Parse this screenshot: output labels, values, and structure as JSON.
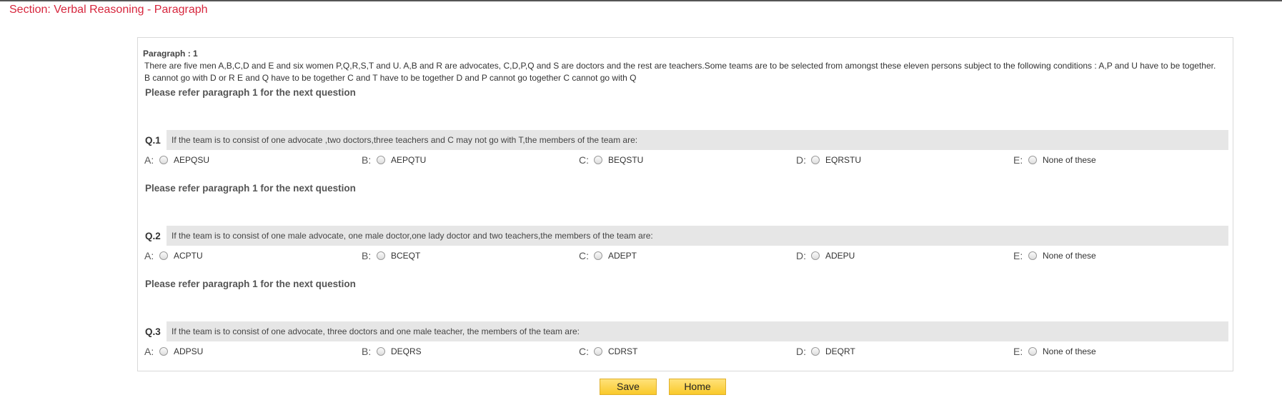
{
  "section_title": "Section: Verbal Reasoning - Paragraph",
  "paragraph": {
    "label": "Paragraph : 1",
    "text": "There are five men A,B,C,D and E and six women P,Q,R,S,T and U. A,B and R are advocates, C,D,P,Q and S are doctors and the rest are teachers.Some teams are to be selected from amongst these eleven persons subject to the following conditions : A,P and U have to be together. B cannot go with D or R E and Q have to be together C and T have to be together D and P cannot go together C cannot go with Q"
  },
  "questions": [
    {
      "refer": "Please refer paragraph 1 for the next question",
      "number": "Q.1",
      "text": "If the team is to consist of one advocate ,two doctors,three teachers and C may not go with T,the members of the team are:",
      "options": [
        {
          "letter": "A:",
          "label": "AEPQSU"
        },
        {
          "letter": "B:",
          "label": "AEPQTU"
        },
        {
          "letter": "C:",
          "label": "BEQSTU"
        },
        {
          "letter": "D:",
          "label": "EQRSTU"
        },
        {
          "letter": "E:",
          "label": "None of these"
        }
      ]
    },
    {
      "refer": "Please refer paragraph 1 for the next question",
      "number": "Q.2",
      "text": "If the team is to consist of one male advocate, one male doctor,one lady doctor and two teachers,the members of the team are:",
      "options": [
        {
          "letter": "A:",
          "label": "ACPTU"
        },
        {
          "letter": "B:",
          "label": "BCEQT"
        },
        {
          "letter": "C:",
          "label": "ADEPT"
        },
        {
          "letter": "D:",
          "label": "ADEPU"
        },
        {
          "letter": "E:",
          "label": "None of these"
        }
      ]
    },
    {
      "refer": "Please refer paragraph 1 for the next question",
      "number": "Q.3",
      "text": "If the team is to consist of one advocate, three doctors and one male teacher, the members of the team are:",
      "options": [
        {
          "letter": "A:",
          "label": "ADPSU"
        },
        {
          "letter": "B:",
          "label": "DEQRS"
        },
        {
          "letter": "C:",
          "label": "CDRST"
        },
        {
          "letter": "D:",
          "label": "DEQRT"
        },
        {
          "letter": "E:",
          "label": "None of these"
        }
      ]
    }
  ],
  "buttons": {
    "save": "Save",
    "home": "Home"
  }
}
